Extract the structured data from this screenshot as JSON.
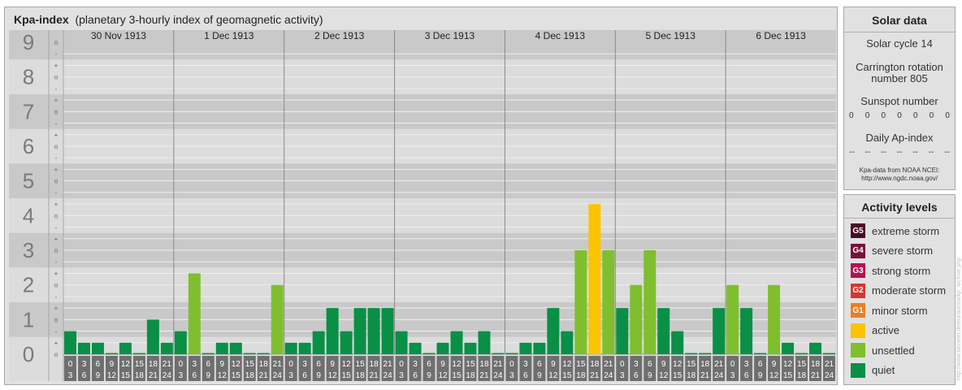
{
  "header": {
    "title": "Kpa-index",
    "subtitle": "(planetary 3-hourly index of geomagnetic activity)"
  },
  "chart_data": {
    "type": "bar",
    "title": "Kpa-index",
    "subtitle": "(planetary 3-hourly index of geomagnetic activity)",
    "ylim": [
      0,
      9
    ],
    "y_ticks": [
      "0",
      "1",
      "2",
      "3",
      "4",
      "5",
      "6",
      "7",
      "8",
      "9"
    ],
    "minor_ticks": [
      "-",
      "o",
      "+"
    ],
    "days": [
      "30 Nov 1913",
      "1 Dec 1913",
      "2 Dec 1913",
      "3 Dec 1913",
      "4 Dec 1913",
      "5 Dec 1913",
      "6 Dec 1913"
    ],
    "interval_start": [
      "0",
      "3",
      "6",
      "9",
      "12",
      "15",
      "18",
      "21"
    ],
    "interval_end": [
      "3",
      "6",
      "9",
      "12",
      "15",
      "18",
      "21",
      "24"
    ],
    "values": [
      [
        0.667,
        0.333,
        0.333,
        0,
        0.333,
        0,
        1,
        0.333
      ],
      [
        0.667,
        2.333,
        0,
        0.333,
        0.333,
        0,
        0,
        2
      ],
      [
        0.333,
        0.333,
        0.667,
        1.333,
        0.667,
        1.333,
        1.333,
        1.333
      ],
      [
        0.667,
        0.333,
        0,
        0.333,
        0.667,
        0.333,
        0.667,
        0
      ],
      [
        0,
        0.333,
        0.333,
        1.333,
        0.667,
        3,
        4.333,
        3
      ],
      [
        1.333,
        2,
        3,
        1.333,
        0.667,
        0,
        0,
        1.333
      ],
      [
        2,
        1.333,
        0,
        2,
        0.333,
        0,
        0.333,
        0
      ]
    ],
    "grid": true
  },
  "solar": {
    "title": "Solar data",
    "cycle": "Solar cycle 14",
    "carrington_line1": "Carrington rotation",
    "carrington_line2": "number 805",
    "sunspot_label": "Sunspot number",
    "sunspot_values": [
      "0",
      "0",
      "0",
      "0",
      "0",
      "0",
      "0"
    ],
    "ap_label": "Daily Ap-index",
    "ap_values": [
      "--",
      "--",
      "--",
      "--",
      "--",
      "--",
      "--"
    ],
    "source_line1": "Kpa-data from NOAA NCEI:",
    "source_line2": "http://www.ngdc.noaa.gov/"
  },
  "levels": {
    "title": "Activity levels",
    "items": [
      {
        "badge": "G5",
        "label": "extreme storm",
        "color": "#4d0a26"
      },
      {
        "badge": "G4",
        "label": "severe storm",
        "color": "#7a0f3a"
      },
      {
        "badge": "G3",
        "label": "strong storm",
        "color": "#b5124f"
      },
      {
        "badge": "G2",
        "label": "moderate storm",
        "color": "#d9362c"
      },
      {
        "badge": "G1",
        "label": "minor storm",
        "color": "#e98024"
      },
      {
        "badge": "",
        "label": "active",
        "color": "#fbc300"
      },
      {
        "badge": "",
        "label": "unsettled",
        "color": "#7fbf2e"
      },
      {
        "badge": "",
        "label": "quiet",
        "color": "#0a8f47"
      }
    ]
  },
  "colors": {
    "quiet": "#0a8f47",
    "unsettled": "#7fbf2e",
    "active": "#fbc300",
    "band_dark": "#c9c9c9",
    "band_light": "#dcdcdc"
  },
  "watermark": "http://www.tieuseei.de/eia/aurora/kp_archive.php"
}
